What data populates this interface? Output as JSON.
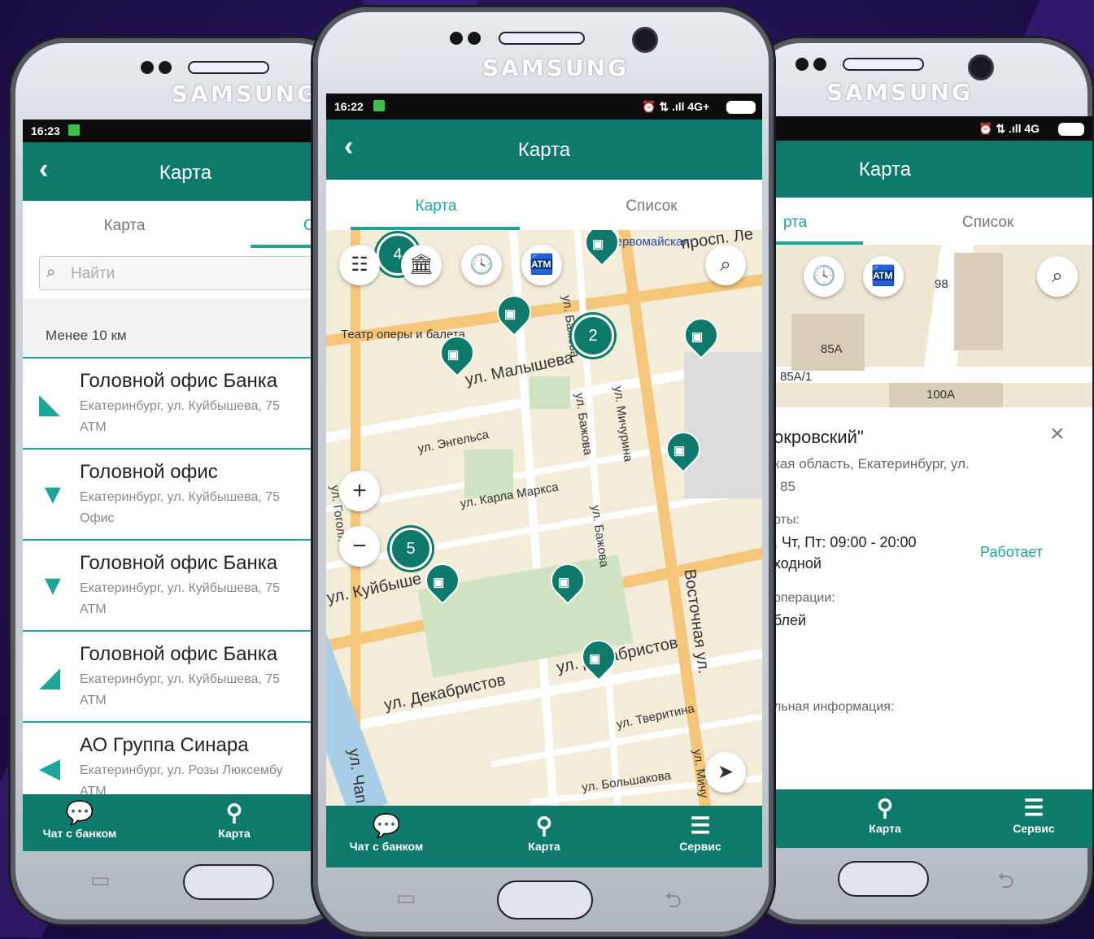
{
  "left": {
    "brand": "SAMSUNG",
    "time": "16:23",
    "title": "Карта",
    "tab_map": "Карта",
    "tab_list_clip": "С",
    "search_placeholder": "Найти",
    "filter": "Менее 10 км",
    "items": [
      {
        "name": "Головной офис Банка",
        "address": "Екатеринбург, ул. Куйбышева, 75",
        "kind": "ATM",
        "arrow": "◣"
      },
      {
        "name": "Головной офис",
        "address": "Екатеринбург, ул. Куйбышева, 75",
        "kind": "Офис",
        "arrow": "▼"
      },
      {
        "name": "Головной офис Банка",
        "address": "Екатеринбург, ул. Куйбышева, 75",
        "kind": "ATM",
        "arrow": "▼"
      },
      {
        "name": "Головной офис Банка",
        "address": "Екатеринбург, ул. Куйбышева, 75",
        "kind": "ATM",
        "arrow": "◢"
      },
      {
        "name": "АО Группа Синара",
        "address": "Екатеринбург, ул. Розы Люксембу",
        "kind": "ATM",
        "arrow": "◀"
      }
    ],
    "nav_chat": "Чат с банком",
    "nav_map": "Карта"
  },
  "center": {
    "brand": "SAMSUNG",
    "time": "16:22",
    "status_right": "⏰ ⇅ .ıll 4G+",
    "title": "Карта",
    "tab_map": "Карта",
    "tab_list": "Список",
    "streets": {
      "malysheva": "ул. Малышева",
      "engelsa": "ул. Энгельса",
      "karla_marksa": "ул. Карла Маркса",
      "kuibysheva": "ул. Куйбыше",
      "dekabristov1": "ул. Декабристов",
      "dekabristov2": "ул. Декабристов",
      "tveritina": "ул. Тверитина",
      "bolshakova": "ул. Большакова",
      "vostochnaya": "Восточная ул.",
      "michurina": "ул. Мичурина",
      "bazhova1": "ул. Бажова",
      "bazhova2": "ул. Бажова",
      "bazhova3": "ул. Бажова",
      "gogolya": "ул. Гоголя",
      "pervomaiskaya": "Первомайская",
      "prosp": "просп. Ле",
      "theatre": "Театр оперы и балета",
      "chap": "ул. Чап",
      "michu2": "ул. Мичу"
    },
    "clusters": [
      "4",
      "2",
      "5"
    ],
    "nav_chat": "Чат с банком",
    "nav_map": "Карта",
    "nav_service": "Сервис"
  },
  "right": {
    "brand": "SAMSUNG",
    "status_right": "⏰ ⇅ .ıll 4G",
    "title": "Карта",
    "tab_map": "рта",
    "tab_list": "Список",
    "buildings": [
      "98",
      "85А",
      "85А/1",
      "100А"
    ],
    "detail": {
      "name": "окровский\"",
      "address": "кая область, Екатеринбург, ул.",
      "house": "85",
      "hours_label": "оты:",
      "hours": ", Чт, Пт: 09:00 - 20:00",
      "day_off": "ходной",
      "status": "Работает",
      "ops_label": "операции:",
      "ops": "блей",
      "info_label": "льная информация:",
      "colon": ":"
    },
    "nav_map": "Карта",
    "nav_service": "Сервис"
  },
  "colors": {
    "primary": "#0d7a6c",
    "accent": "#1ba697"
  }
}
